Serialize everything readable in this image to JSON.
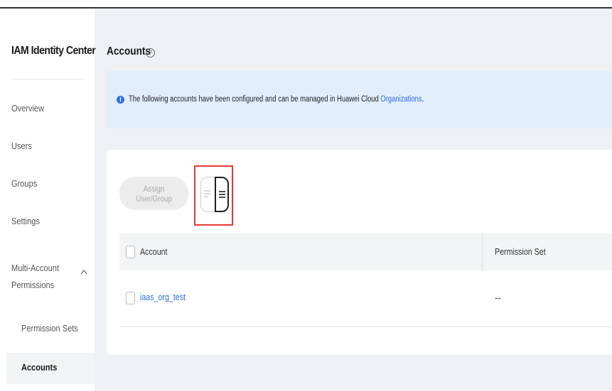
{
  "sidebar": {
    "title": "IAM Identity Center",
    "items": [
      {
        "label": "Overview"
      },
      {
        "label": "Users"
      },
      {
        "label": "Groups"
      },
      {
        "label": "Settings"
      }
    ],
    "group": {
      "label": "Multi-Account Permissions",
      "expanded": true
    },
    "sub_items": [
      {
        "label": "Permission Sets"
      },
      {
        "label": "Accounts",
        "active": true
      }
    ]
  },
  "main": {
    "title": "Accounts",
    "help_icon": "?",
    "banner": {
      "icon": "i",
      "text": "The following accounts have been configured and can be managed in Huawei Cloud ",
      "link": "Organizations",
      "suffix": "."
    },
    "toolbar": {
      "assign_label": "Assign User/Group",
      "view_toggle": {
        "left_icon": "list-icon",
        "right_icon": "detail-list-icon",
        "selected": "right"
      }
    },
    "table": {
      "columns": [
        "Account",
        "Permission Set"
      ],
      "rows": [
        {
          "account": "iaas_org_test",
          "permission_set": "--"
        }
      ]
    }
  },
  "colors": {
    "accent": "#2b6fe6",
    "banner_bg": "#e2edfc",
    "highlight": "#e53935"
  }
}
